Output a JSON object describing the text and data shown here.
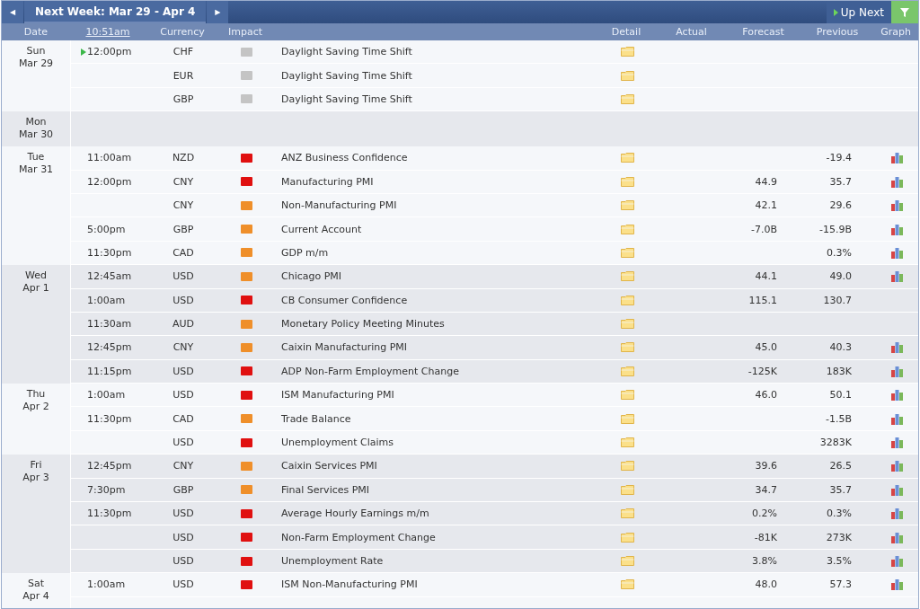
{
  "nav": {
    "prev": "◀",
    "week": "Next Week: Mar 29 - Apr 4",
    "next": "▶",
    "up_next": "Up Next"
  },
  "columns": {
    "date": "Date",
    "time": "10:51am",
    "currency": "Currency",
    "impact": "Impact",
    "detail": "Detail",
    "actual": "Actual",
    "forecast": "Forecast",
    "previous": "Previous",
    "graph": "Graph"
  },
  "days": [
    {
      "day": "Sun",
      "date": "Mar 29",
      "events": [
        {
          "time": "12:00pm",
          "next": true,
          "currency": "CHF",
          "color": "#c4c4c4",
          "event": "Daylight Saving Time Shift",
          "graph": false
        },
        {
          "next": false,
          "currency": "EUR",
          "color": "#c4c4c4",
          "event": "Daylight Saving Time Shift",
          "graph": false
        },
        {
          "next": false,
          "currency": "GBP",
          "color": "#c4c4c4",
          "event": "Daylight Saving Time Shift",
          "graph": false
        }
      ]
    },
    {
      "day": "Mon",
      "date": "Mar 30"
    },
    {
      "day": "Tue",
      "date": "Mar 31",
      "events": [
        {
          "time": "11:00am",
          "next": false,
          "currency": "NZD",
          "color": "#e01010",
          "event": "ANZ Business Confidence",
          "previous": "-19.4",
          "graph": true
        },
        {
          "time": "12:00pm",
          "next": false,
          "currency": "CNY",
          "color": "#e01010",
          "event": "Manufacturing PMI",
          "forecast": "44.9",
          "previous": "35.7",
          "graph": true
        },
        {
          "next": false,
          "currency": "CNY",
          "color": "#ef8f2a",
          "event": "Non-Manufacturing PMI",
          "forecast": "42.1",
          "previous": "29.6",
          "graph": true
        },
        {
          "time": "5:00pm",
          "next": false,
          "currency": "GBP",
          "color": "#ef8f2a",
          "event": "Current Account",
          "forecast": "-7.0B",
          "previous": "-15.9B",
          "graph": true
        },
        {
          "time": "11:30pm",
          "next": false,
          "currency": "CAD",
          "color": "#ef8f2a",
          "event": "GDP m/m",
          "previous": "0.3%",
          "graph": true
        }
      ]
    },
    {
      "day": "Wed",
      "date": "Apr 1",
      "events": [
        {
          "time": "12:45am",
          "next": false,
          "currency": "USD",
          "color": "#ef8f2a",
          "event": "Chicago PMI",
          "forecast": "44.1",
          "previous": "49.0",
          "graph": true
        },
        {
          "time": "1:00am",
          "next": false,
          "currency": "USD",
          "color": "#e01010",
          "event": "CB Consumer Confidence",
          "forecast": "115.1",
          "previous": "130.7",
          "graph": false
        },
        {
          "time": "11:30am",
          "next": false,
          "currency": "AUD",
          "color": "#ef8f2a",
          "event": "Monetary Policy Meeting Minutes",
          "graph": false
        },
        {
          "time": "12:45pm",
          "next": false,
          "currency": "CNY",
          "color": "#ef8f2a",
          "event": "Caixin Manufacturing PMI",
          "forecast": "45.0",
          "previous": "40.3",
          "graph": true
        },
        {
          "time": "11:15pm",
          "next": false,
          "currency": "USD",
          "color": "#e01010",
          "event": "ADP Non-Farm Employment Change",
          "forecast": "-125K",
          "previous": "183K",
          "graph": true
        }
      ]
    },
    {
      "day": "Thu",
      "date": "Apr 2",
      "events": [
        {
          "time": "1:00am",
          "next": false,
          "currency": "USD",
          "color": "#e01010",
          "event": "ISM Manufacturing PMI",
          "forecast": "46.0",
          "previous": "50.1",
          "graph": true
        },
        {
          "time": "11:30pm",
          "next": false,
          "currency": "CAD",
          "color": "#ef8f2a",
          "event": "Trade Balance",
          "previous": "-1.5B",
          "graph": true
        },
        {
          "next": false,
          "currency": "USD",
          "color": "#e01010",
          "event": "Unemployment Claims",
          "previous": "3283K",
          "graph": true
        }
      ]
    },
    {
      "day": "Fri",
      "date": "Apr 3",
      "events": [
        {
          "time": "12:45pm",
          "next": false,
          "currency": "CNY",
          "color": "#ef8f2a",
          "event": "Caixin Services PMI",
          "forecast": "39.6",
          "previous": "26.5",
          "graph": true
        },
        {
          "time": "7:30pm",
          "next": false,
          "currency": "GBP",
          "color": "#ef8f2a",
          "event": "Final Services PMI",
          "forecast": "34.7",
          "previous": "35.7",
          "graph": true
        },
        {
          "time": "11:30pm",
          "next": false,
          "currency": "USD",
          "color": "#e01010",
          "event": "Average Hourly Earnings m/m",
          "forecast": "0.2%",
          "previous": "0.3%",
          "graph": true
        },
        {
          "next": false,
          "currency": "USD",
          "color": "#e01010",
          "event": "Non-Farm Employment Change",
          "forecast": "-81K",
          "previous": "273K",
          "graph": true
        },
        {
          "next": false,
          "currency": "USD",
          "color": "#e01010",
          "event": "Unemployment Rate",
          "forecast": "3.8%",
          "previous": "3.5%",
          "graph": true
        }
      ]
    },
    {
      "day": "Sat",
      "date": "Apr 4",
      "events": [
        {
          "time": "1:00am",
          "next": false,
          "currency": "USD",
          "color": "#e01010",
          "event": "ISM Non-Manufacturing PMI",
          "forecast": "48.0",
          "previous": "57.3",
          "graph": true
        }
      ]
    }
  ]
}
